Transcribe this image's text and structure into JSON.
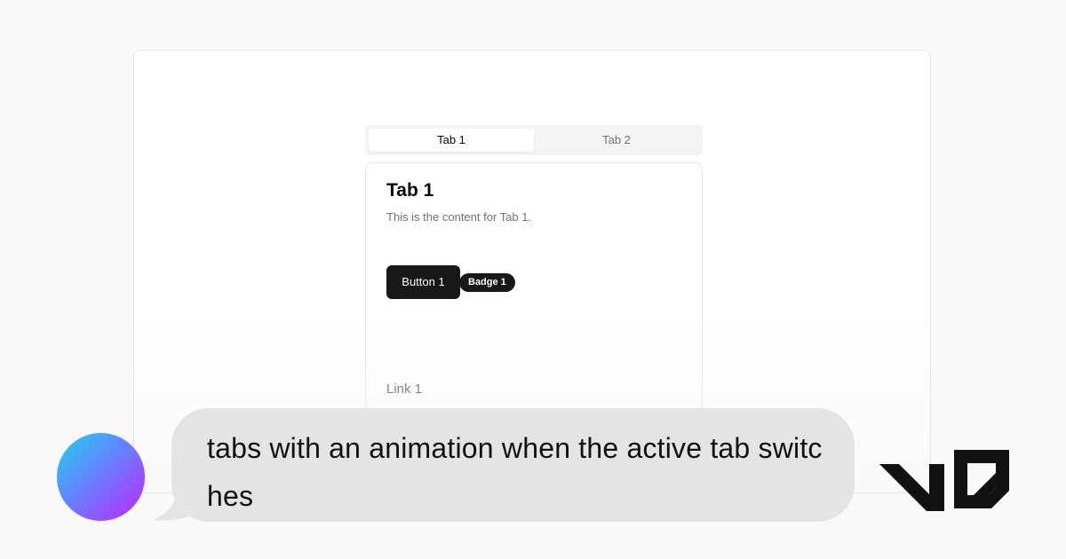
{
  "preview": {
    "tabs": [
      {
        "label": "Tab 1",
        "active": true
      },
      {
        "label": "Tab 2",
        "active": false
      }
    ],
    "panel": {
      "title": "Tab 1",
      "description": "This is the content for Tab 1.",
      "button_label": "Button 1",
      "badge_label": "Badge 1",
      "link_label": "Link 1"
    }
  },
  "prompt": {
    "text": "tabs with an animation when the active tab switches"
  },
  "brand": {
    "logo": "v0-logo"
  },
  "colors": {
    "accent": "#18181b",
    "bubble": "#e4e4e6",
    "avatar_gradient": [
      "#22d3ee",
      "#5b8cff",
      "#c026ff"
    ]
  }
}
